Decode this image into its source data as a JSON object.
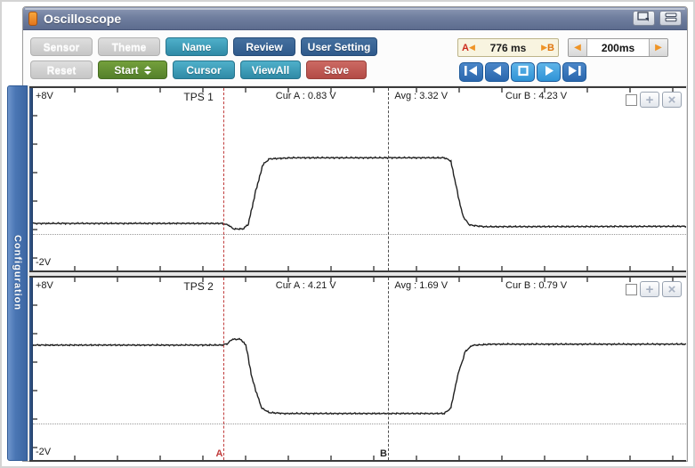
{
  "window": {
    "title": "Oscilloscope"
  },
  "icons": {
    "arrow_left": "◀",
    "arrow_right": "▶"
  },
  "toolbar": {
    "row1": [
      {
        "label": "Sensor",
        "style": "gray"
      },
      {
        "label": "Theme",
        "style": "gray"
      },
      {
        "label": "Name",
        "style": "teal"
      },
      {
        "label": "Review",
        "style": "blue"
      },
      {
        "label": "User Setting",
        "style": "blue"
      }
    ],
    "row2": [
      {
        "label": "Reset",
        "style": "gray"
      },
      {
        "label": "Start",
        "style": "green"
      },
      {
        "label": "Cursor",
        "style": "teal"
      },
      {
        "label": "ViewAll",
        "style": "teal"
      },
      {
        "label": "Save",
        "style": "red"
      }
    ],
    "ab_readout": {
      "a_label": "A",
      "value": "776 ms",
      "b_label": "B"
    },
    "timebase": {
      "value": "200ms"
    },
    "transport": [
      "skip-to-start",
      "step-back",
      "stop",
      "play",
      "skip-to-end"
    ]
  },
  "sidebar": {
    "label": "Configuration"
  },
  "channels": [
    {
      "name": "TPS 1",
      "v_top": "+8V",
      "v_bottom": "-2V",
      "cur_a": "Cur A : 0.83 V",
      "avg": "Avg : 3.32 V",
      "cur_b": "Cur B : 4.23 V"
    },
    {
      "name": "TPS 2",
      "v_top": "+8V",
      "v_bottom": "-2V",
      "cur_a": "Cur A : 4.21 V",
      "avg": "Avg : 1.69 V",
      "cur_b": "Cur B : 0.79 V"
    }
  ],
  "cursors": {
    "a_label": "A",
    "b_label": "B",
    "a_color": "#c03b3b",
    "b_color": "#4d4d4d"
  },
  "colors": {
    "titlebar": "#65759a",
    "teal": "#3598b4",
    "blue": "#36679e",
    "green": "#5f8d2f",
    "red": "#bf5454",
    "orange": "#ef9426",
    "config_tab": "#4a76b4"
  },
  "chart_data": {
    "type": "line",
    "title": "Throttle position sensor A/B waveforms",
    "y_axis": {
      "top_volts": 8,
      "bottom_volts": -2,
      "unit": "V",
      "top_label": "+8V",
      "bottom_label": "-2V"
    },
    "x_axis": {
      "timebase": "200ms",
      "cursor_a_to_b": "776 ms"
    },
    "cursors": {
      "a_frac": 0.296,
      "b_frac": 0.546
    },
    "series": [
      {
        "name": "TPS 1",
        "measurements": {
          "cursor_a_volts": 0.83,
          "avg_volts": 3.32,
          "cursor_b_volts": 4.23
        },
        "points": [
          [
            0,
            0.58
          ],
          [
            0.29,
            0.58
          ],
          [
            0.3,
            0.48
          ],
          [
            0.307,
            0.28
          ],
          [
            0.322,
            0.28
          ],
          [
            0.33,
            0.55
          ],
          [
            0.34,
            2.2
          ],
          [
            0.352,
            3.8
          ],
          [
            0.362,
            4.12
          ],
          [
            0.4,
            4.18
          ],
          [
            0.63,
            4.18
          ],
          [
            0.64,
            4.0
          ],
          [
            0.648,
            2.6
          ],
          [
            0.658,
            1.0
          ],
          [
            0.668,
            0.5
          ],
          [
            0.69,
            0.4
          ],
          [
            1,
            0.42
          ]
        ]
      },
      {
        "name": "TPS 2",
        "measurements": {
          "cursor_a_volts": 4.21,
          "avg_volts": 1.69,
          "cursor_b_volts": 0.79
        },
        "points": [
          [
            0,
            4.3
          ],
          [
            0.29,
            4.3
          ],
          [
            0.298,
            4.38
          ],
          [
            0.305,
            4.62
          ],
          [
            0.318,
            4.62
          ],
          [
            0.326,
            4.3
          ],
          [
            0.336,
            2.4
          ],
          [
            0.35,
            0.85
          ],
          [
            0.362,
            0.6
          ],
          [
            0.385,
            0.55
          ],
          [
            0.63,
            0.55
          ],
          [
            0.64,
            0.85
          ],
          [
            0.65,
            2.6
          ],
          [
            0.662,
            3.95
          ],
          [
            0.672,
            4.28
          ],
          [
            0.7,
            4.35
          ],
          [
            1,
            4.35
          ]
        ]
      }
    ]
  }
}
